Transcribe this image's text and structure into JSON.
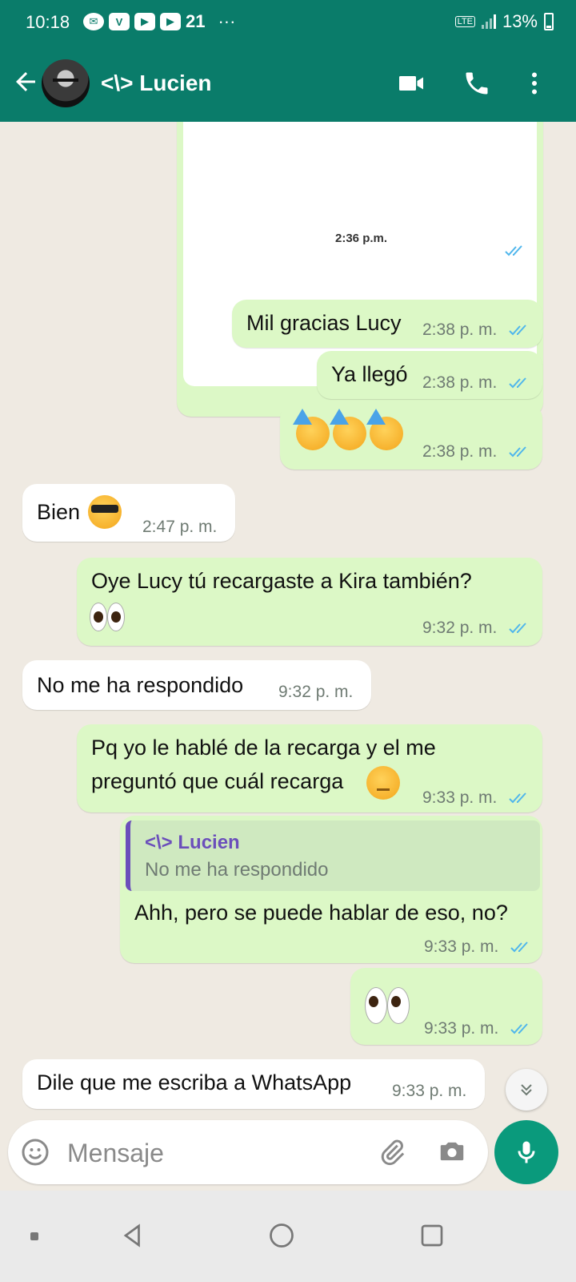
{
  "status_bar": {
    "time": "10:18",
    "signal_tag": "LTE",
    "battery": "13%"
  },
  "header": {
    "contact_name": "<\\> Lucien"
  },
  "image_message": {
    "caption_time": "2:36 p.m.",
    "time": "2:38 p. m."
  },
  "messages": [
    {
      "dir": "out",
      "text": "Mil gracias Lucy",
      "time": "2:38 p. m."
    },
    {
      "dir": "out",
      "text": "Ya llegó",
      "time": "2:38 p. m."
    },
    {
      "dir": "out",
      "emoji": "partying-face x3",
      "time": "2:38 p. m."
    },
    {
      "dir": "in",
      "text": "Bien",
      "emoji": "sunglasses-face",
      "time": "2:47 p. m."
    },
    {
      "dir": "out",
      "text": "Oye Lucy tú recargaste a Kira también?",
      "emoji": "eyes",
      "time": "9:32 p. m."
    },
    {
      "dir": "in",
      "text": "No me ha respondido",
      "time": "9:32 p. m."
    },
    {
      "dir": "out",
      "text_line1": "Pq yo le hablé de la recarga y el me",
      "text_line2": "preguntó que cuál recarga",
      "emoji": "hushed-face",
      "time": "9:33 p. m."
    },
    {
      "dir": "out",
      "reply_to_name": "<\\> Lucien",
      "reply_to_text": "No me ha respondido",
      "text": "Ahh, pero se puede hablar de eso, no?",
      "time": "9:33 p. m."
    },
    {
      "dir": "out",
      "emoji": "eyes",
      "time": "9:33 p. m."
    },
    {
      "dir": "in",
      "text": "Dile que me escriba a WhatsApp",
      "time": "9:33 p. m."
    }
  ],
  "composer": {
    "placeholder": "Mensaje"
  },
  "colors": {
    "header": "#0a7c6a",
    "outgoing": "#dcf8c6",
    "incoming": "#ffffff",
    "read_ticks": "#4fb6ec",
    "mic": "#0a9a7c",
    "reply_accent": "#6b4fbb"
  }
}
